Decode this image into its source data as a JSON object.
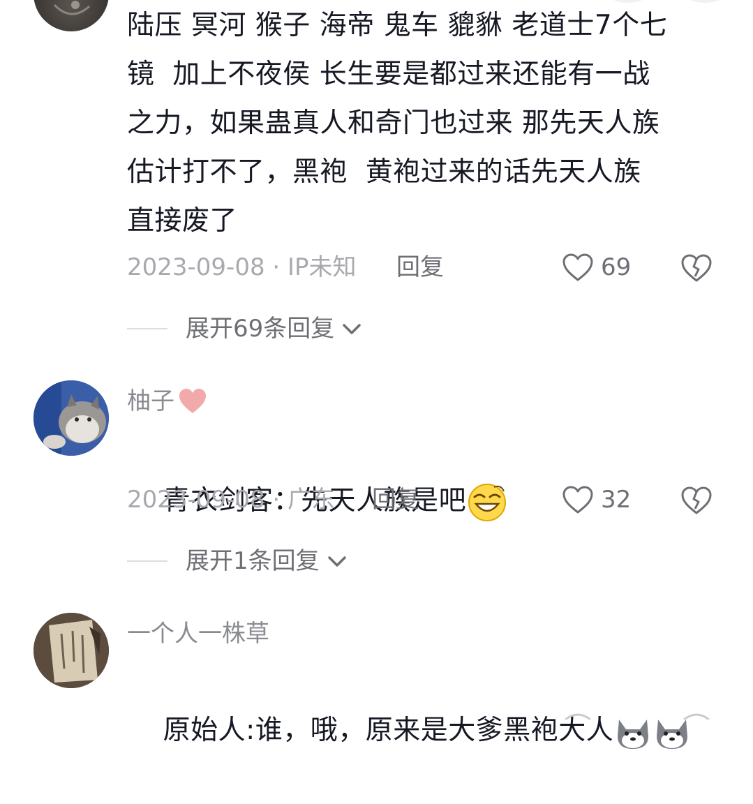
{
  "comments": [
    {
      "username": "",
      "text": "陆压 冥河 猴子 海帝 鬼车 貔貅 老道士7个七\n镜  加上不夜侯 长生要是都过来还能有一战\n之力，如果蛊真人和奇门也过来 那先天人族\n估计打不了，黑袍  黄袍过来的话先天人族\n直接废了",
      "date": "2023-09-08",
      "location": "IP未知",
      "meta": "2023-09-08 · IP未知",
      "reply_label": "回复",
      "likes": "69",
      "expand_label": "展开69条回复"
    },
    {
      "username": "柚子",
      "text": "青衣剑客：先天人族是吧",
      "date": "2023-09-08",
      "location": "广东",
      "meta": "2023-09-08 · 广东",
      "reply_label": "回复",
      "likes": "32",
      "expand_label": "展开1条回复"
    },
    {
      "username": "一个人一株草",
      "text": "原始人:谁，哦，原来是大爹黑袍大人"
    }
  ],
  "colors": {
    "text": "#161823",
    "meta": "#a8a9ae",
    "action": "#6e6f75",
    "heart_badge": "#f2a9a9"
  }
}
